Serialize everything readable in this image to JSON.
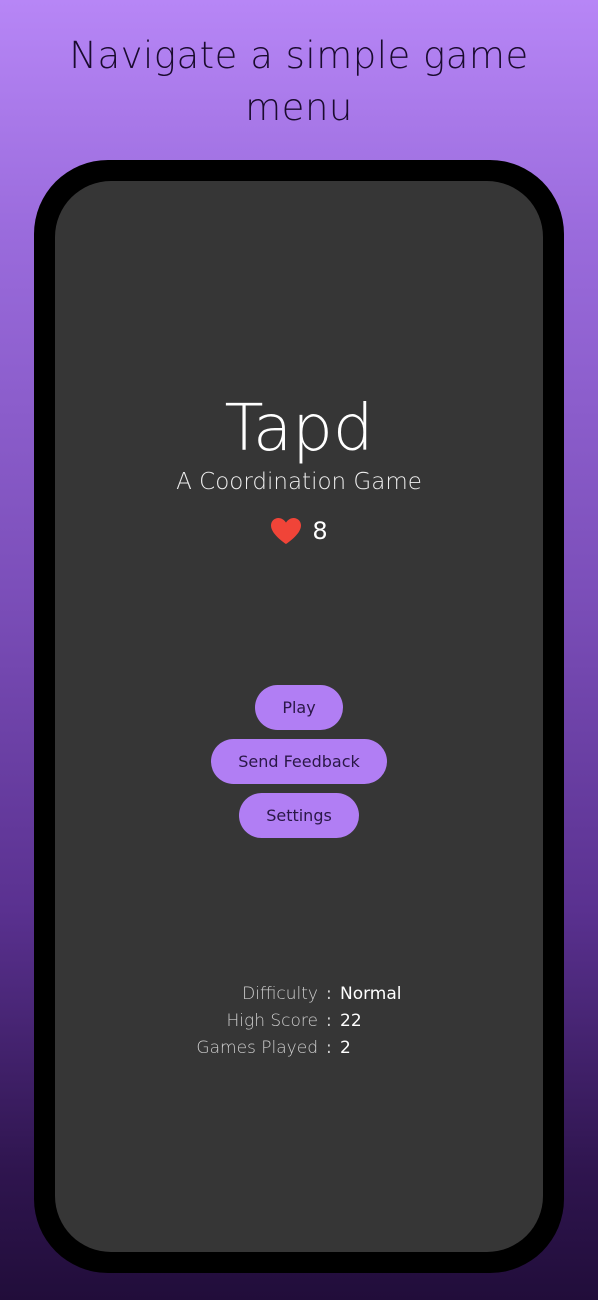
{
  "caption": "Navigate a simple game menu",
  "app": {
    "title": "Tapd",
    "subtitle": "A Coordination Game",
    "lives": {
      "icon": "heart-icon",
      "count": "8"
    },
    "menu": [
      {
        "label": "Play"
      },
      {
        "label": "Send Feedback"
      },
      {
        "label": "Settings"
      }
    ],
    "stats": [
      {
        "label": "Difficulty",
        "separator": ":",
        "value": "Normal"
      },
      {
        "label": "High Score",
        "separator": ":",
        "value": "22"
      },
      {
        "label": "Games Played",
        "separator": ":",
        "value": "2"
      }
    ]
  },
  "colors": {
    "background_top": "#b786f6",
    "background_bottom": "#210d3a",
    "screen": "#363636",
    "button": "#b17ef4",
    "heart": "#f04438"
  }
}
